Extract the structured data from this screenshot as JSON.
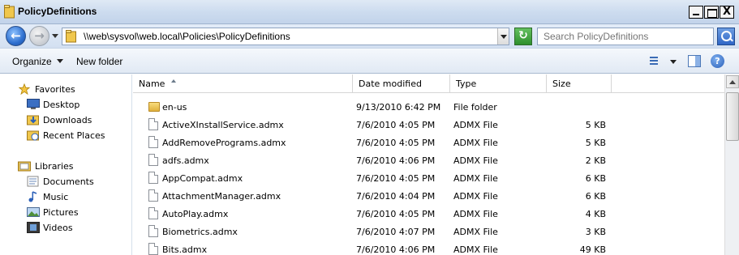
{
  "window": {
    "title": "PolicyDefinitions",
    "controls": {
      "minimize": "_",
      "maximize": "□",
      "close": "X"
    }
  },
  "address_bar": {
    "path": "\\\\web\\sysvol\\web.local\\Policies\\PolicyDefinitions",
    "search_placeholder": "Search PolicyDefinitions"
  },
  "toolbar": {
    "organize_label": "Organize",
    "new_folder_label": "New folder"
  },
  "nav_pane": {
    "favorites": {
      "label": "Favorites",
      "items": [
        {
          "label": "Desktop",
          "icon": "desktop-icon"
        },
        {
          "label": "Downloads",
          "icon": "downloads-icon"
        },
        {
          "label": "Recent Places",
          "icon": "recent-places-icon"
        }
      ]
    },
    "libraries": {
      "label": "Libraries",
      "items": [
        {
          "label": "Documents",
          "icon": "documents-icon"
        },
        {
          "label": "Music",
          "icon": "music-icon"
        },
        {
          "label": "Pictures",
          "icon": "pictures-icon"
        },
        {
          "label": "Videos",
          "icon": "videos-icon"
        }
      ]
    }
  },
  "columns": [
    "Name",
    "Date modified",
    "Type",
    "Size"
  ],
  "files": [
    {
      "name": "en-us",
      "date": "9/13/2010 6:42 PM",
      "type": "File folder",
      "size": "",
      "icon": "folder-icon"
    },
    {
      "name": "ActiveXInstallService.admx",
      "date": "7/6/2010 4:05 PM",
      "type": "ADMX File",
      "size": "5 KB",
      "icon": "file-icon"
    },
    {
      "name": "AddRemovePrograms.admx",
      "date": "7/6/2010 4:05 PM",
      "type": "ADMX File",
      "size": "5 KB",
      "icon": "file-icon"
    },
    {
      "name": "adfs.admx",
      "date": "7/6/2010 4:06 PM",
      "type": "ADMX File",
      "size": "2 KB",
      "icon": "file-icon"
    },
    {
      "name": "AppCompat.admx",
      "date": "7/6/2010 4:05 PM",
      "type": "ADMX File",
      "size": "6 KB",
      "icon": "file-icon"
    },
    {
      "name": "AttachmentManager.admx",
      "date": "7/6/2010 4:04 PM",
      "type": "ADMX File",
      "size": "6 KB",
      "icon": "file-icon"
    },
    {
      "name": "AutoPlay.admx",
      "date": "7/6/2010 4:05 PM",
      "type": "ADMX File",
      "size": "4 KB",
      "icon": "file-icon"
    },
    {
      "name": "Biometrics.admx",
      "date": "7/6/2010 4:07 PM",
      "type": "ADMX File",
      "size": "3 KB",
      "icon": "file-icon"
    },
    {
      "name": "Bits.admx",
      "date": "7/6/2010 4:06 PM",
      "type": "ADMX File",
      "size": "49 KB",
      "icon": "file-icon"
    }
  ]
}
